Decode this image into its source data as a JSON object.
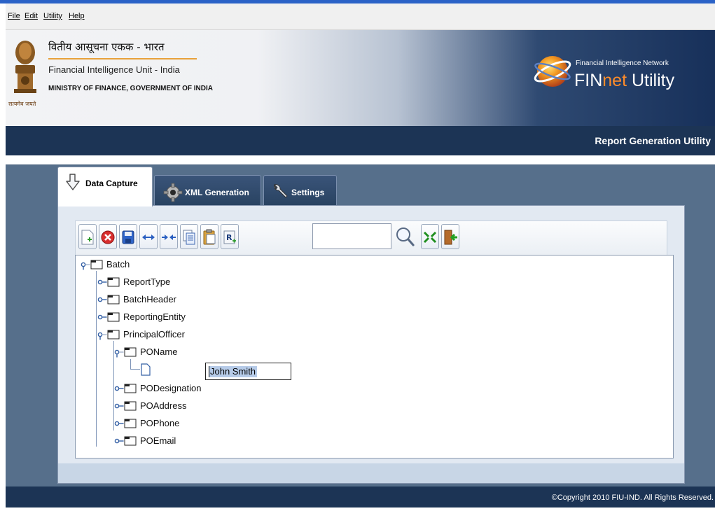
{
  "menu": {
    "file": "File",
    "edit": "Edit",
    "utility": "Utility",
    "help": "Help"
  },
  "header": {
    "hindi_title": "वितीय आसूचना एकक - भारत",
    "unit_name": "Financial Intelligence Unit - India",
    "ministry": "MINISTRY OF FINANCE, GOVERNMENT OF INDIA",
    "emblem_motto": "सत्यमेव जयते",
    "network_label": "Financial Intelligence Network",
    "brand_fin": "FIN",
    "brand_net": "net",
    "brand_utility": " Utility"
  },
  "strip": {
    "title": "Report Generation Utility"
  },
  "tabs": [
    {
      "label": "Data Capture",
      "icon": "hand-down-icon",
      "active": true
    },
    {
      "label": "XML Generation",
      "icon": "gear-icon",
      "active": false
    },
    {
      "label": "Settings",
      "icon": "wrench-icon",
      "active": false
    }
  ],
  "toolbar": {
    "buttons": [
      "new-document-icon",
      "delete-icon",
      "save-icon",
      "expand-icon",
      "collapse-icon",
      "copy-icon",
      "paste-icon",
      "report-icon"
    ],
    "search_value": "",
    "tools": [
      "search-icon",
      "fit-icon",
      "exit-icon"
    ]
  },
  "tree": {
    "root": "Batch",
    "children": [
      "ReportType",
      "BatchHeader",
      "ReportingEntity",
      "PrincipalOfficer"
    ],
    "po_children": [
      "POName",
      "PODesignation",
      "POAddress",
      "POPhone",
      "POEmail"
    ],
    "editing_value": "John Smith"
  },
  "footer": {
    "copyright": "©Copyright 2010 FIU-IND. All Rights Reserved."
  },
  "colors": {
    "banner_dark": "#1c3455",
    "main_bg": "#566f8b",
    "brand_orange": "#ff8c2a",
    "accent_line": "#e8a13a"
  }
}
